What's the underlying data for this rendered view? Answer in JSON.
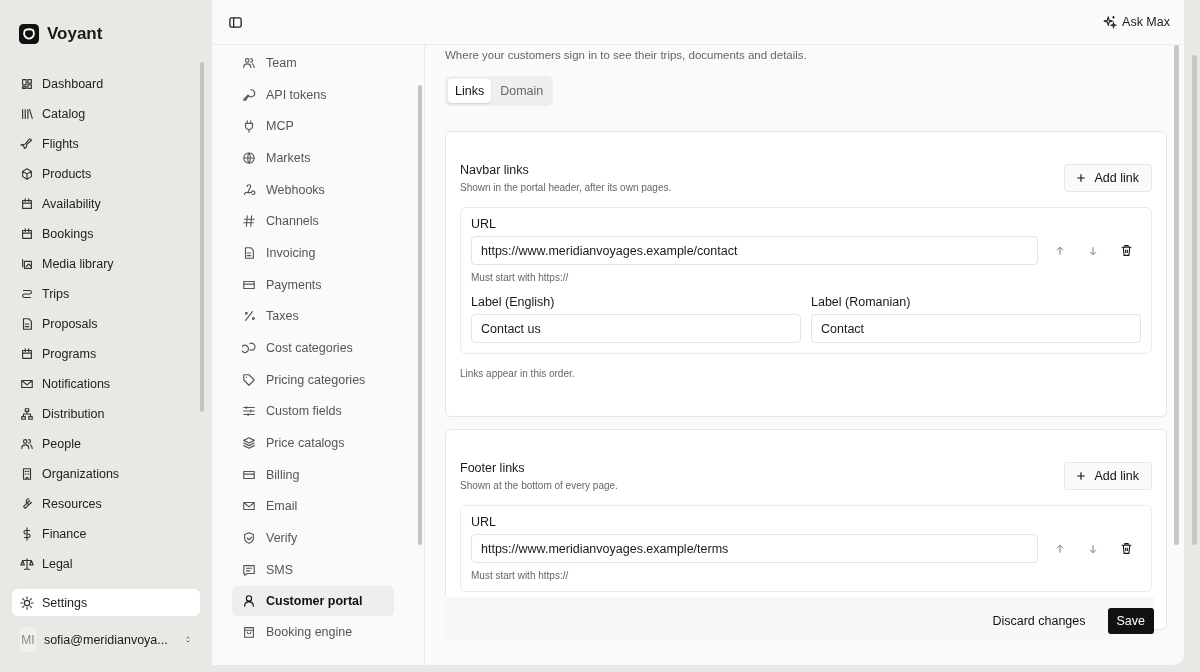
{
  "sidebar": {
    "brand": "Voyant",
    "items": [
      {
        "label": "Dashboard",
        "selected": false
      },
      {
        "label": "Catalog",
        "selected": false
      },
      {
        "label": "Flights",
        "selected": false
      },
      {
        "label": "Products",
        "selected": false
      },
      {
        "label": "Availability",
        "selected": false
      },
      {
        "label": "Bookings",
        "selected": false
      },
      {
        "label": "Media library",
        "selected": false
      },
      {
        "label": "Trips",
        "selected": false
      },
      {
        "label": "Proposals",
        "selected": false
      },
      {
        "label": "Programs",
        "selected": false
      },
      {
        "label": "Notifications",
        "selected": false
      },
      {
        "label": "Distribution",
        "selected": false
      },
      {
        "label": "People",
        "selected": false
      },
      {
        "label": "Organizations",
        "selected": false
      },
      {
        "label": "Resources",
        "selected": false
      },
      {
        "label": "Finance",
        "selected": false
      },
      {
        "label": "Legal",
        "selected": false
      }
    ],
    "settings": {
      "label": "Settings",
      "selected": true
    },
    "user": {
      "initials": "MI",
      "email": "sofia@meridianvoya..."
    }
  },
  "header": {
    "ask_button": "Ask Max"
  },
  "settings_nav": {
    "items": [
      {
        "label": "Team",
        "selected": false
      },
      {
        "label": "API tokens",
        "selected": false
      },
      {
        "label": "MCP",
        "selected": false
      },
      {
        "label": "Markets",
        "selected": false
      },
      {
        "label": "Webhooks",
        "selected": false
      },
      {
        "label": "Channels",
        "selected": false
      },
      {
        "label": "Invoicing",
        "selected": false
      },
      {
        "label": "Payments",
        "selected": false
      },
      {
        "label": "Taxes",
        "selected": false
      },
      {
        "label": "Cost categories",
        "selected": false
      },
      {
        "label": "Pricing categories",
        "selected": false
      },
      {
        "label": "Custom fields",
        "selected": false
      },
      {
        "label": "Price catalogs",
        "selected": false
      },
      {
        "label": "Billing",
        "selected": false
      },
      {
        "label": "Email",
        "selected": false
      },
      {
        "label": "Verify",
        "selected": false
      },
      {
        "label": "SMS",
        "selected": false
      },
      {
        "label": "Customer portal",
        "selected": true
      },
      {
        "label": "Booking engine",
        "selected": false
      }
    ]
  },
  "page": {
    "description": "Where your customers sign in to see their trips, documents and details.",
    "tabs": [
      {
        "label": "Links",
        "selected": true
      },
      {
        "label": "Domain",
        "selected": false
      }
    ],
    "sections": [
      {
        "title": "Navbar links",
        "description": "Shown in the portal header, after its own pages.",
        "add_button": "Add link",
        "note": "Links appear in this order.",
        "links": [
          {
            "url_label": "URL",
            "url": "https://www.meridianvoyages.example/contact",
            "hint": "Must start with https://",
            "labels": [
              {
                "label": "Label (English)",
                "value": "Contact us"
              },
              {
                "label": "Label (Romanian)",
                "value": "Contact"
              }
            ]
          }
        ]
      },
      {
        "title": "Footer links",
        "description": "Shown at the bottom of every page.",
        "add_button": "Add link",
        "links": [
          {
            "url_label": "URL",
            "url": "https://www.meridianvoyages.example/terms",
            "hint": "Must start with https://"
          }
        ]
      }
    ]
  },
  "save_bar": {
    "discard": "Discard changes",
    "save": "Save"
  }
}
